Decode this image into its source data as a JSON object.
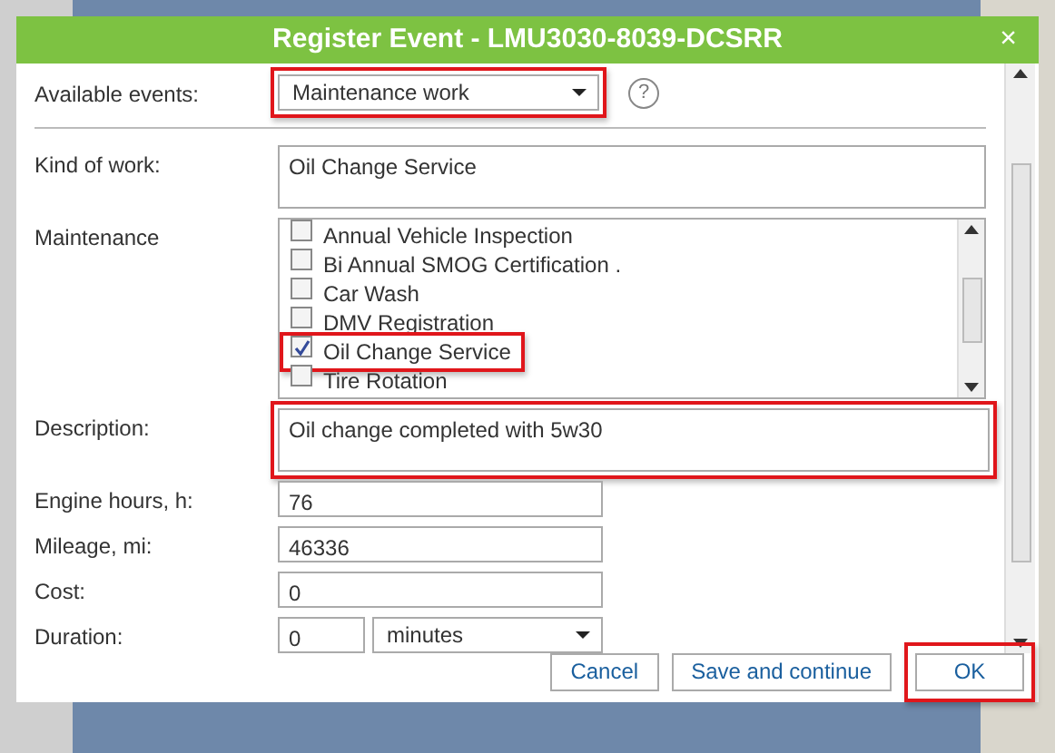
{
  "dialog": {
    "title": "Register Event - LMU3030-8039-DCSRR",
    "close": "×"
  },
  "fields": [
    {
      "kind": "select",
      "label": "Available events:",
      "value": "Maintenance work",
      "highlighted": true,
      "help": "?"
    },
    {
      "kind": "divider"
    },
    {
      "kind": "textarea",
      "label": "Kind of work:",
      "value": "Oil Change Service"
    },
    {
      "kind": "checklist",
      "label": "Maintenance",
      "items": [
        {
          "label": "Annual Vehicle Inspection",
          "checked": false
        },
        {
          "label": "Bi Annual SMOG Certification .",
          "checked": false
        },
        {
          "label": "Car Wash",
          "checked": false
        },
        {
          "label": "DMV Registration",
          "checked": false
        },
        {
          "label": "Oil Change Service",
          "checked": true,
          "highlighted": true
        },
        {
          "label": "Tire Rotation",
          "checked": false
        }
      ]
    },
    {
      "kind": "textarea",
      "label": "Description:",
      "value": "Oil change completed with 5w30",
      "highlighted": true
    },
    {
      "kind": "input",
      "label": "Engine hours, h:",
      "value": "76"
    },
    {
      "kind": "input",
      "label": "Mileage, mi:",
      "value": "46336"
    },
    {
      "kind": "input",
      "label": "Cost:",
      "value": "0"
    },
    {
      "kind": "duration",
      "label": "Duration:",
      "value": "0",
      "unit": "minutes"
    },
    {
      "kind": "stub"
    }
  ],
  "buttons": [
    {
      "label": "Cancel"
    },
    {
      "label": "Save and continue"
    },
    {
      "label": "OK",
      "highlighted": true
    }
  ]
}
